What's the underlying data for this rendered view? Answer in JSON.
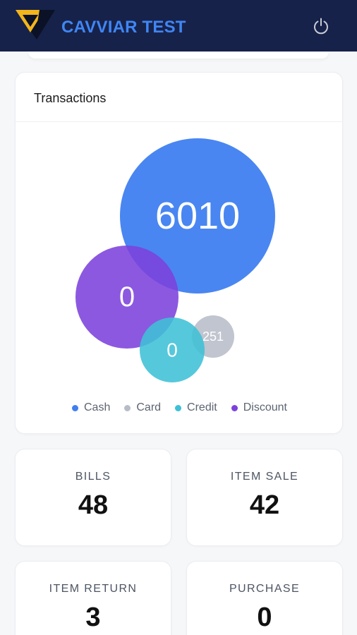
{
  "app": {
    "brand": "CAVVIAR TEST",
    "logo_icon": "cavviar-v-logo-icon",
    "power_icon": "power-icon"
  },
  "transactions": {
    "title": "Transactions"
  },
  "chart_data": {
    "type": "bubble",
    "series": [
      {
        "name": "Cash",
        "value": 6010,
        "color": "#3f7ff0"
      },
      {
        "name": "Card",
        "value": 0,
        "color": "#b7bdc8"
      },
      {
        "name": "Credit",
        "value": 0,
        "color": "#3fc0d6"
      },
      {
        "name": "Discount",
        "value": 251,
        "color": "#7c41dc"
      }
    ],
    "bubble_labels": [
      "6010",
      "251",
      "0",
      "0"
    ],
    "legend": [
      "Cash",
      "Card",
      "Credit",
      "Discount"
    ],
    "legend_position": "bottom"
  },
  "stats": {
    "bills": {
      "label": "BILLS",
      "value": "48"
    },
    "item_sale": {
      "label": "ITEM SALE",
      "value": "42"
    },
    "item_return": {
      "label": "ITEM RETURN",
      "value": "3"
    },
    "purchase": {
      "label": "PURCHASE",
      "value": "0"
    }
  }
}
